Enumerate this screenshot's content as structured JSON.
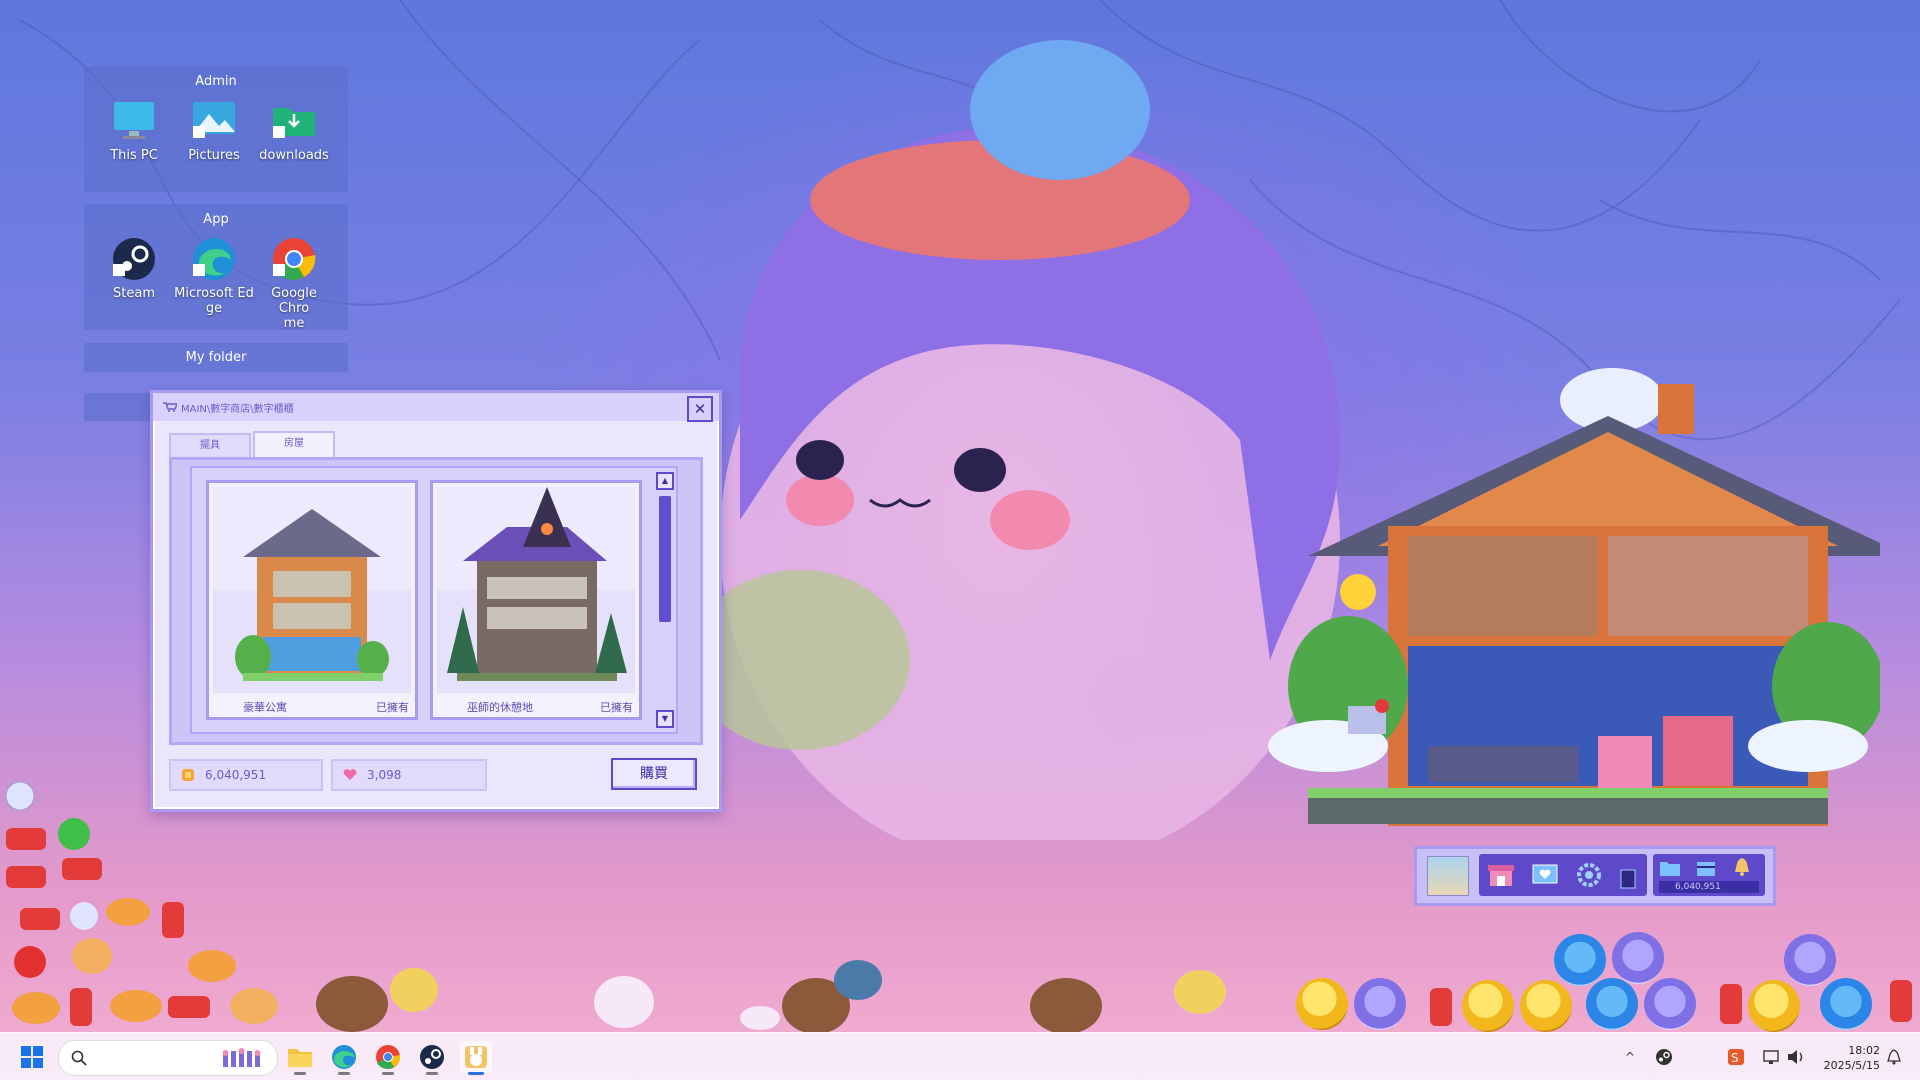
{
  "desktop": {
    "groups": [
      {
        "title": "Admin",
        "icons": [
          {
            "label": "This PC",
            "icon": "monitor-icon"
          },
          {
            "label": "Pictures",
            "icon": "pictures-icon"
          },
          {
            "label": "downloads",
            "icon": "folder-download-icon"
          }
        ]
      },
      {
        "title": "App",
        "icons": [
          {
            "label": "Steam",
            "icon": "steam-icon"
          },
          {
            "label": "Microsoft Ed\nge",
            "icon": "edge-icon"
          },
          {
            "label": "Google Chro\nme",
            "icon": "chrome-icon"
          }
        ]
      }
    ],
    "folder_label": "My folder"
  },
  "shop": {
    "title": "MAIN\\數字商店\\數字櫃櫃",
    "tabs": [
      {
        "label": "擺具",
        "active": false
      },
      {
        "label": "房屋",
        "active": true
      }
    ],
    "items": [
      {
        "name": "豪華公寓",
        "status": "已擁有"
      },
      {
        "name": "巫師的休憩地",
        "status": "已擁有"
      }
    ],
    "coins": "6,040,951",
    "hearts": "3,098",
    "buy_label": "購買"
  },
  "widget": {
    "coins": "6,040,951"
  },
  "taskbar": {
    "time": "18:02",
    "date": "2025/5/15",
    "apps": [
      "file-explorer-icon",
      "edge-icon",
      "chrome-icon",
      "steam-icon",
      "pet-game-icon"
    ]
  },
  "colors": {
    "accent": "#5c4bc8",
    "panel": "#cdc4f7",
    "window": "#ebe6fb"
  }
}
